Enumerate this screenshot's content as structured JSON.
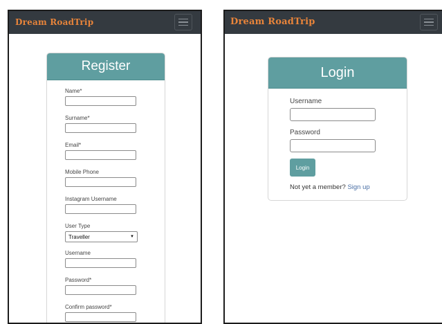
{
  "brand": "Dream RoadTrip",
  "register": {
    "title": "Register",
    "fields": [
      {
        "label": "Name*"
      },
      {
        "label": "Surname*"
      },
      {
        "label": "Email*"
      },
      {
        "label": "Mobile Phone"
      },
      {
        "label": "Instagram Username"
      },
      {
        "label": "User Type",
        "selected": "Traveller"
      },
      {
        "label": "Username"
      },
      {
        "label": "Password*"
      },
      {
        "label": "Confirm password*"
      }
    ]
  },
  "login": {
    "title": "Login",
    "username_label": "Username",
    "password_label": "Password",
    "button": "Login",
    "prompt": "Not yet a member?",
    "signup_link": "Sign up"
  },
  "colors": {
    "navbar": "#343a40",
    "brand": "#e8843a",
    "accent": "#5f9ea0",
    "link": "#4a6fa5"
  },
  "icons": {
    "menu": "hamburger-menu-icon",
    "dropdown": "chevron-down-icon"
  }
}
